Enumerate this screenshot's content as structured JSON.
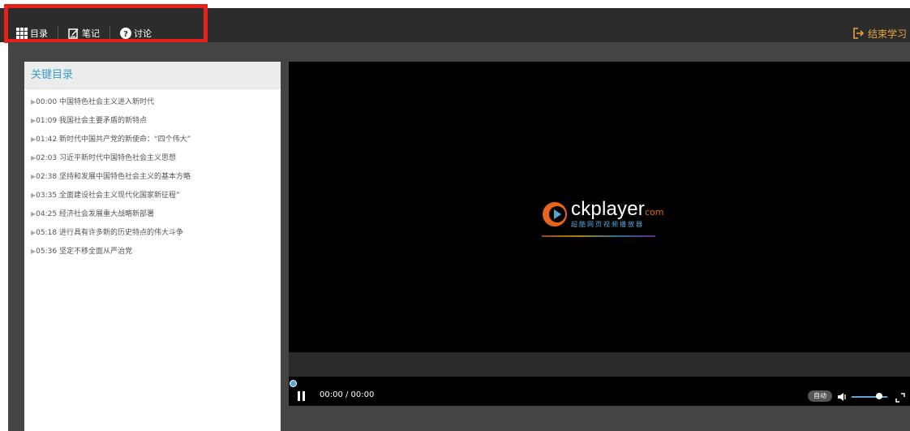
{
  "topbar": {
    "nav": [
      {
        "label": "目录",
        "icon": "grid-icon"
      },
      {
        "label": "笔记",
        "icon": "note-icon"
      },
      {
        "label": "讨论",
        "icon": "question-icon"
      }
    ],
    "exit_label": "结束学习",
    "exit_icon": "exit-icon"
  },
  "contents": {
    "title": "关键目录",
    "items": [
      {
        "time": "00:00",
        "title": "中国特色社会主义进入新时代"
      },
      {
        "time": "01:09",
        "title": "我国社会主要矛盾的新特点"
      },
      {
        "time": "01:42",
        "title": "新时代中国共产党的新使命：“四个伟大”"
      },
      {
        "time": "02:03",
        "title": "习近平新时代中国特色社会主义思想"
      },
      {
        "time": "02:38",
        "title": "坚持和发展中国特色社会主义的基本方略"
      },
      {
        "time": "03:35",
        "title": "全面建设社会主义现代化国家新征程”"
      },
      {
        "time": "04:25",
        "title": "经济社会发展重大战略新部署"
      },
      {
        "time": "05:18",
        "title": "进行具有许多新的历史特点的伟大斗争"
      },
      {
        "time": "05:36",
        "title": "坚定不移全面从严治党"
      }
    ]
  },
  "player": {
    "logo_main": "ckplayer",
    "logo_suffix": "com",
    "logo_sub": "超酷网页视频播放器",
    "time": "00:00 / 00:00",
    "auto_label": "自动",
    "colors": {
      "accent": "#5aa4d8",
      "exit": "#e8a33c",
      "highlight": "#e8201a"
    }
  }
}
